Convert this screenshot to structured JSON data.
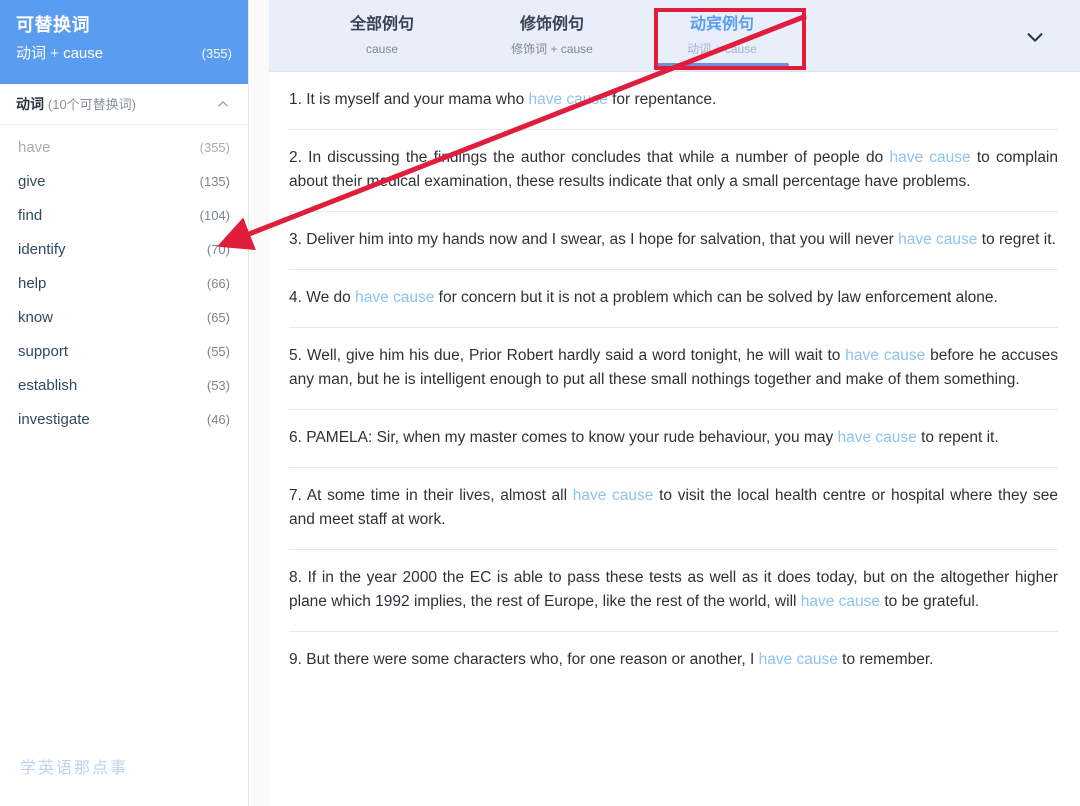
{
  "sidebar": {
    "header": {
      "title": "可替换词",
      "subtitle": "动词 + cause",
      "count": "(355)"
    },
    "group": {
      "label": "动词",
      "count": "(10个可替换词)",
      "toggle_icon": "chevron-up-icon"
    },
    "items": [
      {
        "word": "have",
        "count": "(355)",
        "state": "selected"
      },
      {
        "word": "give",
        "count": "(135)",
        "state": "normal"
      },
      {
        "word": "find",
        "count": "(104)",
        "state": "normal"
      },
      {
        "word": "identify",
        "count": "(70)",
        "state": "normal"
      },
      {
        "word": "help",
        "count": "(66)",
        "state": "normal"
      },
      {
        "word": "know",
        "count": "(65)",
        "state": "normal"
      },
      {
        "word": "support",
        "count": "(55)",
        "state": "normal"
      },
      {
        "word": "establish",
        "count": "(53)",
        "state": "normal"
      },
      {
        "word": "investigate",
        "count": "(46)",
        "state": "normal"
      }
    ],
    "watermark": "学英语那点事"
  },
  "tabs": [
    {
      "title": "全部例句",
      "subtitle": "cause",
      "active": false
    },
    {
      "title": "修饰例句",
      "subtitle": "修饰词 + cause",
      "active": false
    },
    {
      "title": "动宾例句",
      "subtitle": "动词 + cause",
      "active": true
    }
  ],
  "tabbar": {
    "expand_icon": "chevron-down-icon"
  },
  "sentences": [
    {
      "number": "1.",
      "parts": [
        {
          "t": "It is myself and your mama who ",
          "hl": false
        },
        {
          "t": "have cause",
          "hl": true
        },
        {
          "t": " for repentance.",
          "hl": false
        }
      ]
    },
    {
      "number": "2.",
      "parts": [
        {
          "t": "In discussing the findings the author concludes that while a number of people do ",
          "hl": false
        },
        {
          "t": "have cause",
          "hl": true
        },
        {
          "t": " to complain about their medical examination, these results indicate that only a small percentage have problems.",
          "hl": false
        }
      ]
    },
    {
      "number": "3.",
      "parts": [
        {
          "t": "Deliver him into my hands now and I swear, as I hope for salvation, that you will never ",
          "hl": false
        },
        {
          "t": "have cause",
          "hl": true
        },
        {
          "t": " to regret it.",
          "hl": false
        }
      ]
    },
    {
      "number": "4.",
      "parts": [
        {
          "t": "We do ",
          "hl": false
        },
        {
          "t": "have cause",
          "hl": true
        },
        {
          "t": " for concern but it is not a problem which can be solved by law enforcement alone.",
          "hl": false
        }
      ]
    },
    {
      "number": "5.",
      "parts": [
        {
          "t": "Well, give him his due, Prior Robert hardly said a word tonight, he will wait to ",
          "hl": false
        },
        {
          "t": "have cause",
          "hl": true
        },
        {
          "t": " before he accuses any man, but he is intelligent enough to put all these small nothings together and make of them something.",
          "hl": false
        }
      ]
    },
    {
      "number": "6.",
      "parts": [
        {
          "t": "PAMELA: Sir, when my master comes to know your rude behaviour, you may ",
          "hl": false
        },
        {
          "t": "have cause",
          "hl": true
        },
        {
          "t": " to repent it.",
          "hl": false
        }
      ]
    },
    {
      "number": "7.",
      "parts": [
        {
          "t": "At some time in their lives, almost all ",
          "hl": false
        },
        {
          "t": "have cause",
          "hl": true
        },
        {
          "t": " to visit the local health centre or hospital where they see and meet staff at work.",
          "hl": false
        }
      ]
    },
    {
      "number": "8.",
      "parts": [
        {
          "t": "If in the year 2000 the EC is able to pass these tests as well as it does today, but on the altogether higher plane which 1992 implies, the rest of Europe, like the rest of the world, will ",
          "hl": false
        },
        {
          "t": "have cause",
          "hl": true
        },
        {
          "t": " to be grateful.",
          "hl": false
        }
      ]
    },
    {
      "number": "9.",
      "parts": [
        {
          "t": "But there were some characters who, for one reason or another, I ",
          "hl": false
        },
        {
          "t": "have cause",
          "hl": true
        },
        {
          "t": " to remember.",
          "hl": false
        }
      ]
    }
  ],
  "annotation": {
    "box_target": "动宾例句",
    "arrow_from": "动宾例句",
    "arrow_to": "identify",
    "color": "#e01e3c"
  },
  "colors": {
    "brand_blue": "#5a9cef",
    "tabbar_bg": "#e9eefb",
    "highlight_blue": "#8cc3ef",
    "annotation_red": "#e01e3c"
  }
}
